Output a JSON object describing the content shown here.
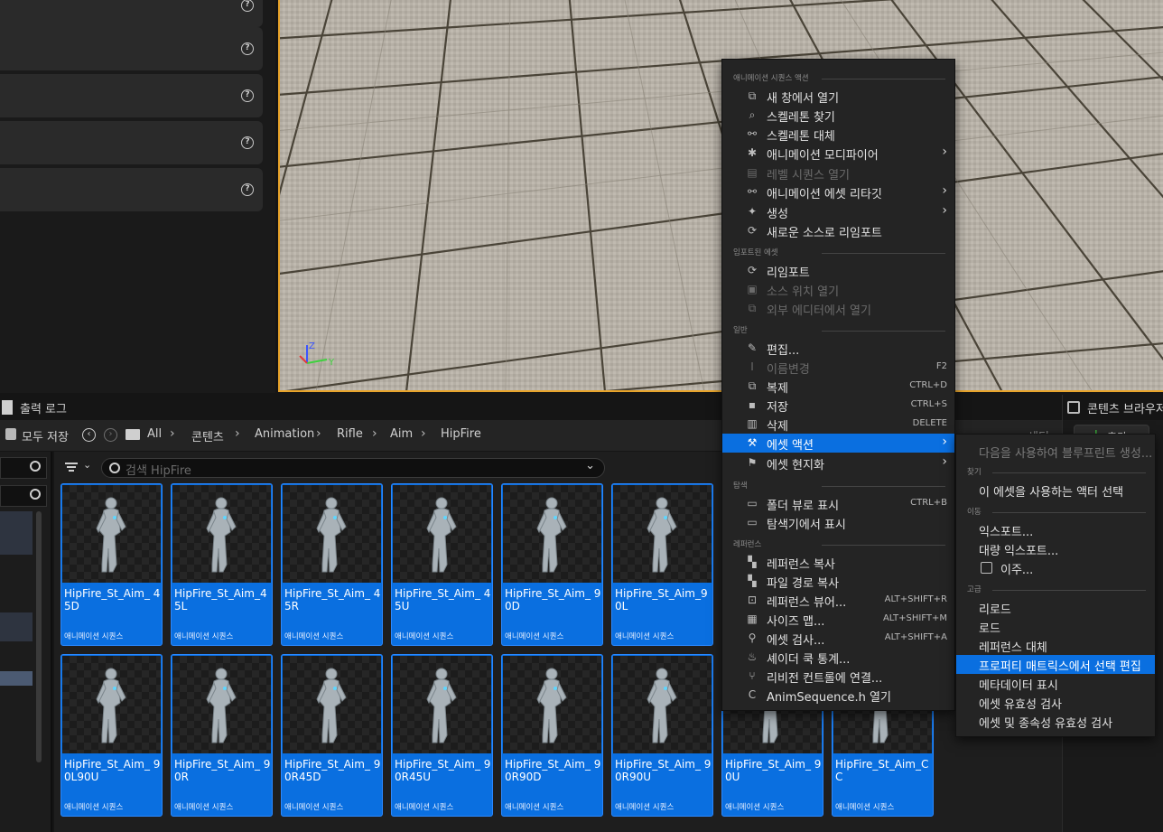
{
  "details_panel": {
    "help_glyph": "?"
  },
  "output_log": {
    "label": "출력 로그"
  },
  "content_browser_tab": {
    "label": "콘텐츠 브라우저"
  },
  "toolbar": {
    "save_all": "모두 저장",
    "breadcrumbs": [
      "All",
      "콘텐츠",
      "Animation",
      "Rifle",
      "Aim",
      "HipFire"
    ],
    "settings_label": "세팅",
    "add_label": "추가"
  },
  "search": {
    "placeholder": "검색 HipFire"
  },
  "assets": [
    {
      "name": "HipFire_St_Aim_ 45D",
      "type": "애니메이션 시퀀스"
    },
    {
      "name": "HipFire_St_Aim_45L",
      "type": "애니메이션 시퀀스"
    },
    {
      "name": "HipFire_St_Aim_ 45R",
      "type": "애니메이션 시퀀스"
    },
    {
      "name": "HipFire_St_Aim_ 45U",
      "type": "애니메이션 시퀀스"
    },
    {
      "name": "HipFire_St_Aim_ 90D",
      "type": "애니메이션 시퀀스"
    },
    {
      "name": "HipFire_St_Aim_90L",
      "type": "애니메이션 시퀀스"
    },
    {
      "name": "HipFire_St_Aim_ 90L90U",
      "type": "애니메이션 시퀀스"
    },
    {
      "name": "HipFire_St_Aim_ 90R",
      "type": "애니메이션 시퀀스"
    },
    {
      "name": "HipFire_St_Aim_ 90R45D",
      "type": "애니메이션 시퀀스"
    },
    {
      "name": "HipFire_St_Aim_ 90R45U",
      "type": "애니메이션 시퀀스"
    },
    {
      "name": "HipFire_St_Aim_ 90R90D",
      "type": "애니메이션 시퀀스"
    },
    {
      "name": "HipFire_St_Aim_ 90R90U",
      "type": "애니메이션 시퀀스"
    },
    {
      "name": "HipFire_St_Aim_ 90U",
      "type": "애니메이션 시퀀스"
    },
    {
      "name": "HipFire_St_Aim_CC",
      "type": "애니메이션 시퀀스"
    }
  ],
  "context_menu": {
    "sections": {
      "anim": "애니메이션 시퀀스 액션",
      "imported": "임포트된 에셋",
      "general": "일반",
      "explore": "탐색",
      "references": "레퍼런스"
    },
    "items": [
      {
        "label": "새 창에서 열기",
        "icon": "open-window-icon",
        "key": "",
        "arrow": false,
        "disabled": false
      },
      {
        "label": "스켈레톤 찾기",
        "icon": "find-skeleton-icon",
        "key": "",
        "arrow": false,
        "disabled": false
      },
      {
        "label": "스켈레톤 대체",
        "icon": "replace-skeleton-icon",
        "key": "",
        "arrow": false,
        "disabled": false
      },
      {
        "label": "애니메이션 모디파이어",
        "icon": "modifier-icon",
        "key": "",
        "arrow": true,
        "disabled": false
      },
      {
        "label": "레벨 시퀀스 열기",
        "icon": "level-sequence-icon",
        "key": "",
        "arrow": false,
        "disabled": true
      },
      {
        "label": "애니메이션 에셋 리타깃",
        "icon": "retarget-icon",
        "key": "",
        "arrow": true,
        "disabled": false
      },
      {
        "label": "생성",
        "icon": "create-icon",
        "key": "",
        "arrow": true,
        "disabled": false
      },
      {
        "label": "새로운 소스로 리임포트",
        "icon": "reimport-new-icon",
        "key": "",
        "arrow": false,
        "disabled": false
      },
      {
        "label": "리임포트",
        "icon": "reimport-icon",
        "key": "",
        "arrow": false,
        "disabled": false
      },
      {
        "label": "소스 위치 열기",
        "icon": "source-location-icon",
        "key": "",
        "arrow": false,
        "disabled": true
      },
      {
        "label": "외부 에디터에서 열기",
        "icon": "external-editor-icon",
        "key": "",
        "arrow": false,
        "disabled": true
      },
      {
        "label": "편집...",
        "icon": "edit-icon",
        "key": "",
        "arrow": false,
        "disabled": false
      },
      {
        "label": "이름변경",
        "icon": "rename-icon",
        "key": "F2",
        "arrow": false,
        "disabled": true
      },
      {
        "label": "복제",
        "icon": "duplicate-icon",
        "key": "CTRL+D",
        "arrow": false,
        "disabled": false
      },
      {
        "label": "저장",
        "icon": "save-icon",
        "key": "CTRL+S",
        "arrow": false,
        "disabled": false
      },
      {
        "label": "삭제",
        "icon": "delete-icon",
        "key": "DELETE",
        "arrow": false,
        "disabled": false
      },
      {
        "label": "에셋 액션",
        "icon": "wrench-icon",
        "key": "",
        "arrow": true,
        "disabled": false
      },
      {
        "label": "에셋 현지화",
        "icon": "flag-icon",
        "key": "",
        "arrow": true,
        "disabled": false
      },
      {
        "label": "폴더 뷰로 표시",
        "icon": "folder-view-icon",
        "key": "CTRL+B",
        "arrow": false,
        "disabled": false
      },
      {
        "label": "탐색기에서 표시",
        "icon": "explorer-icon",
        "key": "",
        "arrow": false,
        "disabled": false
      },
      {
        "label": "레퍼런스 복사",
        "icon": "copy-reference-icon",
        "key": "",
        "arrow": false,
        "disabled": false
      },
      {
        "label": "파일 경로 복사",
        "icon": "copy-path-icon",
        "key": "",
        "arrow": false,
        "disabled": false
      },
      {
        "label": "레퍼런스 뷰어...",
        "icon": "reference-viewer-icon",
        "key": "ALT+SHIFT+R",
        "arrow": false,
        "disabled": false
      },
      {
        "label": "사이즈 맵...",
        "icon": "size-map-icon",
        "key": "ALT+SHIFT+M",
        "arrow": false,
        "disabled": false
      },
      {
        "label": "에셋 검사...",
        "icon": "audit-icon",
        "key": "ALT+SHIFT+A",
        "arrow": false,
        "disabled": false
      },
      {
        "label": "셰이더 쿡 통계...",
        "icon": "shader-cook-icon",
        "key": "",
        "arrow": false,
        "disabled": false
      },
      {
        "label": "리비전 컨트롤에 연결...",
        "icon": "revision-control-icon",
        "key": "",
        "arrow": false,
        "disabled": false
      },
      {
        "label": "AnimSequence.h 열기",
        "icon": "cpp-icon",
        "key": "",
        "arrow": false,
        "disabled": false
      }
    ]
  },
  "submenu": {
    "sections": {
      "find": "찾기",
      "move": "이동",
      "advanced": "고급"
    },
    "items": [
      {
        "label": "다음을 사용하여 블루프린트 생성...",
        "disabled": true
      },
      {
        "label": "이 에셋을 사용하는 액터 선택",
        "disabled": false
      },
      {
        "label": "익스포트...",
        "disabled": false
      },
      {
        "label": "대량 익스포트...",
        "disabled": false
      },
      {
        "label": "이주...",
        "disabled": false
      },
      {
        "label": "리로드",
        "disabled": false
      },
      {
        "label": "로드",
        "disabled": false
      },
      {
        "label": "레퍼런스 대체",
        "disabled": false
      },
      {
        "label": "프로퍼티 매트릭스에서 선택 편집",
        "disabled": false
      },
      {
        "label": "메타데이터 표시",
        "disabled": false
      },
      {
        "label": "에셋 유효성 검사",
        "disabled": false
      },
      {
        "label": "에셋 및 종속성 유효성 검사",
        "disabled": false
      }
    ]
  },
  "colors": {
    "accent": "#0a6fe0",
    "viewport_border": "#e8a42a"
  }
}
